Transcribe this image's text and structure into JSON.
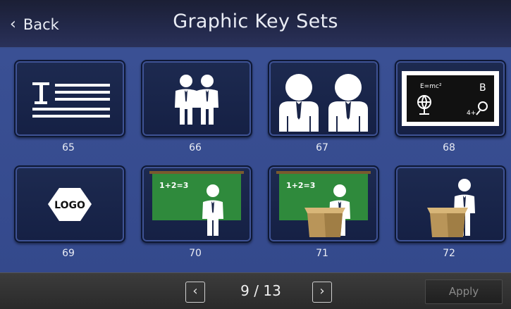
{
  "header": {
    "back_icon": "chevron-left-icon",
    "back_label": "Back",
    "title": "Graphic Key Sets"
  },
  "tiles": [
    {
      "number": "65",
      "icon": "title-text-lines-icon"
    },
    {
      "number": "66",
      "icon": "two-small-people-icon"
    },
    {
      "number": "67",
      "icon": "two-large-people-icon"
    },
    {
      "number": "68",
      "icon": "blackboard-formulas-icon",
      "board_text": {
        "formula": "E=mc²",
        "letter": "B",
        "small": "4+"
      }
    },
    {
      "number": "69",
      "icon": "logo-hexagon-icon",
      "logo_text": "LOGO"
    },
    {
      "number": "70",
      "icon": "green-board-presenter-icon",
      "board_text": "1+2=3"
    },
    {
      "number": "71",
      "icon": "green-board-podium-presenter-icon",
      "board_text": "1+2=3"
    },
    {
      "number": "72",
      "icon": "podium-presenter-icon"
    }
  ],
  "footer": {
    "prev_icon": "chevron-left-icon",
    "next_icon": "chevron-right-icon",
    "page_indicator": "9 / 13",
    "apply_label": "Apply"
  },
  "colors": {
    "header_bg": "#23294b",
    "content_bg": "#34498c",
    "tile_bg": "#1a2548",
    "footer_bg": "#333333",
    "chalkboard_green": "#2f8a3c",
    "podium_tan": "#b99559"
  }
}
